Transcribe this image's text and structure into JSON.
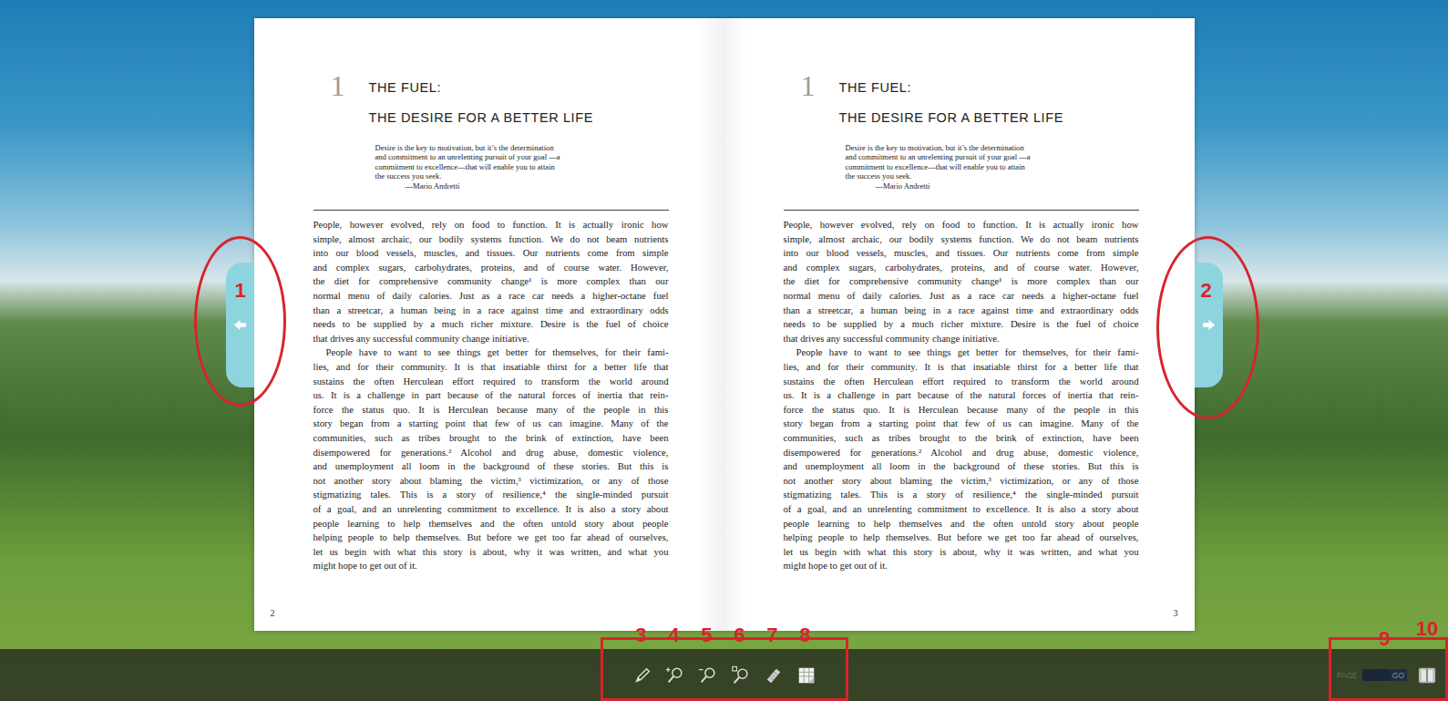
{
  "pages": [
    {
      "chapter": "1",
      "title": [
        "THE FUEL:",
        "THE DESIRE FOR A BETTER LIFE"
      ],
      "epigraph": {
        "lines": [
          "Desire is the key to motivation, but it’s the determination",
          "and commitment to an unrelenting pursuit of your goal —a",
          "commitment to excellence—that will enable you to attain",
          "the success you seek."
        ],
        "attribution": "—Mario Andretti"
      },
      "paragraphs": [
        [
          "People, however evolved, rely on food to function. It is actually ironic how",
          "simple, almost archaic, our bodily systems function. We do not beam nutrients",
          "into our blood vessels, muscles, and tissues. Our nutrients come from simple",
          "and complex sugars, carbohydrates, proteins, and of course water. However,",
          "the diet for comprehensive community change¹ is more complex than our",
          "normal menu of daily calories. Just as a race car needs a higher-octane fuel",
          "than a streetcar, a human being in a race against time and extraordinary odds",
          "needs to be supplied by a much richer mixture. Desire is the fuel of choice",
          "that drives any successful community change initiative."
        ],
        [
          "People have to want to see things get better for themselves, for their fami-",
          "lies, and for their community. It is that insatiable thirst for a better life that",
          "sustains the often Herculean effort required to transform the world around",
          "us. It is a challenge in part because of the natural forces of inertia that rein-",
          "force the status quo. It is Herculean because many of the people in this",
          "story began from a starting point that few of us can imagine. Many of the",
          "communities, such as tribes brought to the brink of extinction, have been",
          "disempowered for generations.² Alcohol and drug abuse, domestic violence,",
          "and unemployment all loom in the background of these stories. But this is",
          "not another story about blaming the victim,³ victimization, or any of those",
          "stigmatizing tales. This is a story of resilience,⁴ the single-minded pursuit",
          "of a goal, and an unrelenting commitment to excellence. It is also a story about",
          "people learning to help themselves and the often untold story about people",
          "helping people to help themselves. But before we get too far ahead of ourselves,",
          "let us begin with what this story is about, why it was written, and what you",
          "might hope to get out of it."
        ]
      ],
      "page_number": "2"
    },
    {
      "chapter": "1",
      "title": [
        "THE FUEL:",
        "THE DESIRE FOR A BETTER LIFE"
      ],
      "epigraph": {
        "lines": [
          "Desire is the key to motivation, but it’s the determination",
          "and commitment to an unrelenting pursuit of your goal —a",
          "commitment to excellence—that will enable you to attain",
          "the success you seek."
        ],
        "attribution": "—Mario Andretti"
      },
      "paragraphs": [
        [
          "People, however evolved, rely on food to function. It is actually ironic how",
          "simple, almost archaic, our bodily systems function. We do not beam nutrients",
          "into our blood vessels, muscles, and tissues. Our nutrients come from simple",
          "and complex sugars, carbohydrates, proteins, and of course water. However,",
          "the diet for comprehensive community change¹ is more complex than our",
          "normal menu of daily calories. Just as a race car needs a higher-octane fuel",
          "than a streetcar, a human being in a race against time and extraordinary odds",
          "needs to be supplied by a much richer mixture. Desire is the fuel of choice",
          "that drives any successful community change initiative."
        ],
        [
          "People have to want to see things get better for themselves, for their fami-",
          "lies, and for their community. It is that insatiable thirst for a better life that",
          "sustains the often Herculean effort required to transform the world around",
          "us. It is a challenge in part because of the natural forces of inertia that rein-",
          "force the status quo. It is Herculean because many of the people in this",
          "story began from a starting point that few of us can imagine. Many of the",
          "communities, such as tribes brought to the brink of extinction, have been",
          "disempowered for generations.² Alcohol and drug abuse, domestic violence,",
          "and unemployment all loom in the background of these stories. But this is",
          "not another story about blaming the victim,³ victimization, or any of those",
          "stigmatizing tales. This is a story of resilience,⁴ the single-minded pursuit",
          "of a goal, and an unrelenting commitment to excellence. It is also a story about",
          "people learning to help themselves and the often untold story about people",
          "helping people to help themselves. But before we get too far ahead of ourselves,",
          "let us begin with what this story is about, why it was written, and what you",
          "might hope to get out of it."
        ]
      ],
      "page_number": "3"
    }
  ],
  "navigation": {
    "previous": {
      "annotation": "1"
    },
    "next": {
      "annotation": "2"
    }
  },
  "toolbar": {
    "tools": [
      {
        "annotation": "3"
      },
      {
        "annotation": "4"
      },
      {
        "annotation": "5"
      },
      {
        "annotation": "6"
      },
      {
        "annotation": "7"
      },
      {
        "annotation": "8"
      }
    ]
  },
  "pager": {
    "label": "PAGE",
    "value": "",
    "go": "GO",
    "go_annotation": "9",
    "book_annotation": "10"
  }
}
